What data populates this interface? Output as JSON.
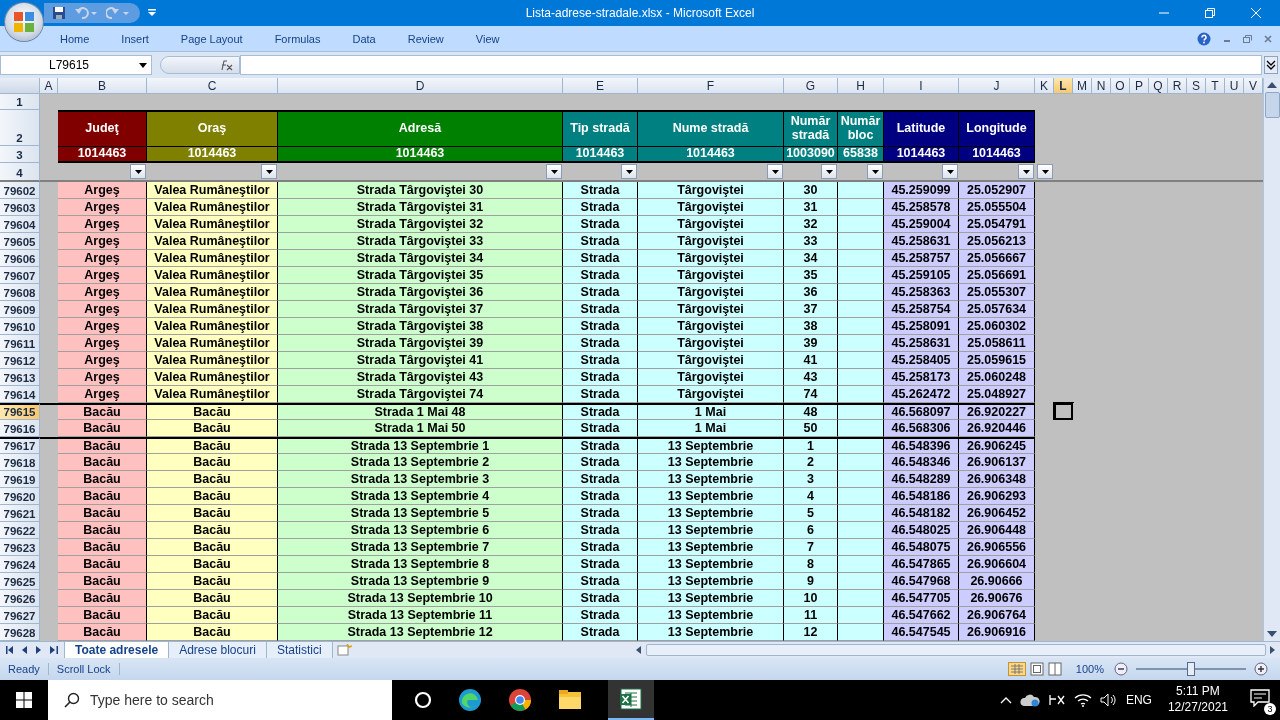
{
  "window": {
    "title": "Lista-adrese-stradale.xlsx - Microsoft Excel"
  },
  "ribbon_tabs": [
    "Home",
    "Insert",
    "Page Layout",
    "Formulas",
    "Data",
    "Review",
    "View"
  ],
  "name_box": "L79615",
  "columns": [
    {
      "letter": "A",
      "selected": false
    },
    {
      "letter": "B",
      "selected": false
    },
    {
      "letter": "C",
      "selected": false
    },
    {
      "letter": "D",
      "selected": false
    },
    {
      "letter": "E",
      "selected": false
    },
    {
      "letter": "F",
      "selected": false
    },
    {
      "letter": "G",
      "selected": false
    },
    {
      "letter": "H",
      "selected": false
    },
    {
      "letter": "I",
      "selected": false
    },
    {
      "letter": "J",
      "selected": false
    },
    {
      "letter": "K",
      "selected": false
    },
    {
      "letter": "L",
      "selected": true
    },
    {
      "letter": "M",
      "selected": false
    },
    {
      "letter": "N",
      "selected": false
    },
    {
      "letter": "O",
      "selected": false
    },
    {
      "letter": "P",
      "selected": false
    },
    {
      "letter": "Q",
      "selected": false
    },
    {
      "letter": "R",
      "selected": false
    },
    {
      "letter": "S",
      "selected": false
    },
    {
      "letter": "T",
      "selected": false
    },
    {
      "letter": "U",
      "selected": false
    },
    {
      "letter": "V",
      "selected": false
    }
  ],
  "table": {
    "blank_row": "1",
    "header_row": "2",
    "count_row": "3",
    "filter_row": "4",
    "fields": [
      {
        "header": "Judeţ",
        "count": "1014463",
        "color": "#800000"
      },
      {
        "header": "Oraş",
        "count": "1014463",
        "color": "#808000"
      },
      {
        "header": "Adresă",
        "count": "1014463",
        "color": "#008000"
      },
      {
        "header": "Tip stradă",
        "count": "1014463",
        "color": "#008080"
      },
      {
        "header": "Nume stradă",
        "count": "1014463",
        "color": "#008080"
      },
      {
        "header": "Număr stradă",
        "count": "1003090",
        "color": "#008080"
      },
      {
        "header": "Număr bloc",
        "count": "65838",
        "color": "#008080"
      },
      {
        "header": "Latitude",
        "count": "1014463",
        "color": "#000080"
      },
      {
        "header": "Longitude",
        "count": "1014463",
        "color": "#000080"
      }
    ],
    "rows": [
      {
        "number": "79602",
        "selected": false,
        "group_start": false,
        "cells": {
          "B": "Argeş",
          "C": "Valea Rumâneştilor",
          "D": "Strada Târgoviştei 30",
          "E": "Strada",
          "F": "Târgoviştei",
          "G": "30",
          "I": "45.259099",
          "J": "25.052907"
        }
      },
      {
        "number": "79603",
        "selected": false,
        "group_start": false,
        "cells": {
          "B": "Argeş",
          "C": "Valea Rumâneştilor",
          "D": "Strada Târgoviştei 31",
          "E": "Strada",
          "F": "Târgoviştei",
          "G": "31",
          "I": "45.258578",
          "J": "25.055504"
        }
      },
      {
        "number": "79604",
        "selected": false,
        "group_start": false,
        "cells": {
          "B": "Argeş",
          "C": "Valea Rumâneştilor",
          "D": "Strada Târgoviştei 32",
          "E": "Strada",
          "F": "Târgoviştei",
          "G": "32",
          "I": "45.259004",
          "J": "25.054791"
        }
      },
      {
        "number": "79605",
        "selected": false,
        "group_start": false,
        "cells": {
          "B": "Argeş",
          "C": "Valea Rumâneştilor",
          "D": "Strada Târgoviştei 33",
          "E": "Strada",
          "F": "Târgoviştei",
          "G": "33",
          "I": "45.258631",
          "J": "25.056213"
        }
      },
      {
        "number": "79606",
        "selected": false,
        "group_start": false,
        "cells": {
          "B": "Argeş",
          "C": "Valea Rumâneştilor",
          "D": "Strada Târgoviştei 34",
          "E": "Strada",
          "F": "Târgoviştei",
          "G": "34",
          "I": "45.258757",
          "J": "25.056667"
        }
      },
      {
        "number": "79607",
        "selected": false,
        "group_start": false,
        "cells": {
          "B": "Argeş",
          "C": "Valea Rumâneştilor",
          "D": "Strada Târgoviştei 35",
          "E": "Strada",
          "F": "Târgoviştei",
          "G": "35",
          "I": "45.259105",
          "J": "25.056691"
        }
      },
      {
        "number": "79608",
        "selected": false,
        "group_start": false,
        "cells": {
          "B": "Argeş",
          "C": "Valea Rumâneştilor",
          "D": "Strada Târgoviştei 36",
          "E": "Strada",
          "F": "Târgoviştei",
          "G": "36",
          "I": "45.258363",
          "J": "25.055307"
        }
      },
      {
        "number": "79609",
        "selected": false,
        "group_start": false,
        "cells": {
          "B": "Argeş",
          "C": "Valea Rumâneştilor",
          "D": "Strada Târgoviştei 37",
          "E": "Strada",
          "F": "Târgoviştei",
          "G": "37",
          "I": "45.258754",
          "J": "25.057634"
        }
      },
      {
        "number": "79610",
        "selected": false,
        "group_start": false,
        "cells": {
          "B": "Argeş",
          "C": "Valea Rumâneştilor",
          "D": "Strada Târgoviştei 38",
          "E": "Strada",
          "F": "Târgoviştei",
          "G": "38",
          "I": "45.258091",
          "J": "25.060302"
        }
      },
      {
        "number": "79611",
        "selected": false,
        "group_start": false,
        "cells": {
          "B": "Argeş",
          "C": "Valea Rumâneştilor",
          "D": "Strada Târgoviştei 39",
          "E": "Strada",
          "F": "Târgoviştei",
          "G": "39",
          "I": "45.258631",
          "J": "25.058611"
        }
      },
      {
        "number": "79612",
        "selected": false,
        "group_start": false,
        "cells": {
          "B": "Argeş",
          "C": "Valea Rumâneştilor",
          "D": "Strada Târgoviştei 41",
          "E": "Strada",
          "F": "Târgoviştei",
          "G": "41",
          "I": "45.258405",
          "J": "25.059615"
        }
      },
      {
        "number": "79613",
        "selected": false,
        "group_start": false,
        "cells": {
          "B": "Argeş",
          "C": "Valea Rumâneştilor",
          "D": "Strada Târgoviştei 43",
          "E": "Strada",
          "F": "Târgoviştei",
          "G": "43",
          "I": "45.258173",
          "J": "25.060248"
        }
      },
      {
        "number": "79614",
        "selected": false,
        "group_start": false,
        "cells": {
          "B": "Argeş",
          "C": "Valea Rumâneştilor",
          "D": "Strada Târgoviştei 74",
          "E": "Strada",
          "F": "Târgoviştei",
          "G": "74",
          "I": "45.262472",
          "J": "25.048927"
        }
      },
      {
        "number": "79615",
        "selected": true,
        "group_start": true,
        "cells": {
          "B": "Bacău",
          "C": "Bacău",
          "D": "Strada 1 Mai 48",
          "E": "Strada",
          "F": "1 Mai",
          "G": "48",
          "I": "46.568097",
          "J": "26.920227"
        }
      },
      {
        "number": "79616",
        "selected": false,
        "group_start": false,
        "cells": {
          "B": "Bacău",
          "C": "Bacău",
          "D": "Strada 1 Mai 50",
          "E": "Strada",
          "F": "1 Mai",
          "G": "50",
          "I": "46.568306",
          "J": "26.920446"
        }
      },
      {
        "number": "79617",
        "selected": false,
        "group_start": true,
        "cells": {
          "B": "Bacău",
          "C": "Bacău",
          "D": "Strada 13 Septembrie 1",
          "E": "Strada",
          "F": "13 Septembrie",
          "G": "1",
          "I": "46.548396",
          "J": "26.906245"
        }
      },
      {
        "number": "79618",
        "selected": false,
        "group_start": false,
        "cells": {
          "B": "Bacău",
          "C": "Bacău",
          "D": "Strada 13 Septembrie 2",
          "E": "Strada",
          "F": "13 Septembrie",
          "G": "2",
          "I": "46.548346",
          "J": "26.906137"
        }
      },
      {
        "number": "79619",
        "selected": false,
        "group_start": false,
        "cells": {
          "B": "Bacău",
          "C": "Bacău",
          "D": "Strada 13 Septembrie 3",
          "E": "Strada",
          "F": "13 Septembrie",
          "G": "3",
          "I": "46.548289",
          "J": "26.906348"
        }
      },
      {
        "number": "79620",
        "selected": false,
        "group_start": false,
        "cells": {
          "B": "Bacău",
          "C": "Bacău",
          "D": "Strada 13 Septembrie 4",
          "E": "Strada",
          "F": "13 Septembrie",
          "G": "4",
          "I": "46.548186",
          "J": "26.906293"
        }
      },
      {
        "number": "79621",
        "selected": false,
        "group_start": false,
        "cells": {
          "B": "Bacău",
          "C": "Bacău",
          "D": "Strada 13 Septembrie 5",
          "E": "Strada",
          "F": "13 Septembrie",
          "G": "5",
          "I": "46.548182",
          "J": "26.906452"
        }
      },
      {
        "number": "79622",
        "selected": false,
        "group_start": false,
        "cells": {
          "B": "Bacău",
          "C": "Bacău",
          "D": "Strada 13 Septembrie 6",
          "E": "Strada",
          "F": "13 Septembrie",
          "G": "6",
          "I": "46.548025",
          "J": "26.906448"
        }
      },
      {
        "number": "79623",
        "selected": false,
        "group_start": false,
        "cells": {
          "B": "Bacău",
          "C": "Bacău",
          "D": "Strada 13 Septembrie 7",
          "E": "Strada",
          "F": "13 Septembrie",
          "G": "7",
          "I": "46.548075",
          "J": "26.906556"
        }
      },
      {
        "number": "79624",
        "selected": false,
        "group_start": false,
        "cells": {
          "B": "Bacău",
          "C": "Bacău",
          "D": "Strada 13 Septembrie 8",
          "E": "Strada",
          "F": "13 Septembrie",
          "G": "8",
          "I": "46.547865",
          "J": "26.906604"
        }
      },
      {
        "number": "79625",
        "selected": false,
        "group_start": false,
        "cells": {
          "B": "Bacău",
          "C": "Bacău",
          "D": "Strada 13 Septembrie 9",
          "E": "Strada",
          "F": "13 Septembrie",
          "G": "9",
          "I": "46.547968",
          "J": "26.90666"
        }
      },
      {
        "number": "79626",
        "selected": false,
        "group_start": false,
        "cells": {
          "B": "Bacău",
          "C": "Bacău",
          "D": "Strada 13 Septembrie 10",
          "E": "Strada",
          "F": "13 Septembrie",
          "G": "10",
          "I": "46.547705",
          "J": "26.90676"
        }
      },
      {
        "number": "79627",
        "selected": false,
        "group_start": false,
        "cells": {
          "B": "Bacău",
          "C": "Bacău",
          "D": "Strada 13 Septembrie 11",
          "E": "Strada",
          "F": "13 Septembrie",
          "G": "11",
          "I": "46.547662",
          "J": "26.906764"
        }
      },
      {
        "number": "79628",
        "selected": false,
        "group_start": false,
        "cells": {
          "B": "Bacău",
          "C": "Bacău",
          "D": "Strada 13 Septembrie 12",
          "E": "Strada",
          "F": "13 Septembrie",
          "G": "12",
          "I": "46.547545",
          "J": "26.906916"
        }
      }
    ]
  },
  "sheet_tabs": [
    {
      "label": "Toate adresele",
      "selected": true
    },
    {
      "label": "Adrese blocuri",
      "selected": false
    },
    {
      "label": "Statistici",
      "selected": false
    }
  ],
  "status_bar": {
    "items": [
      "Ready",
      "Scroll Lock"
    ],
    "zoom": "100%",
    "zoom_level": {
      "level": 0.5
    }
  },
  "taskbar": {
    "search": {
      "placeholder": "Type here to search"
    },
    "language": "ENG",
    "time": "5:11 PM",
    "date": "12/27/2021",
    "notifications": "3"
  }
}
